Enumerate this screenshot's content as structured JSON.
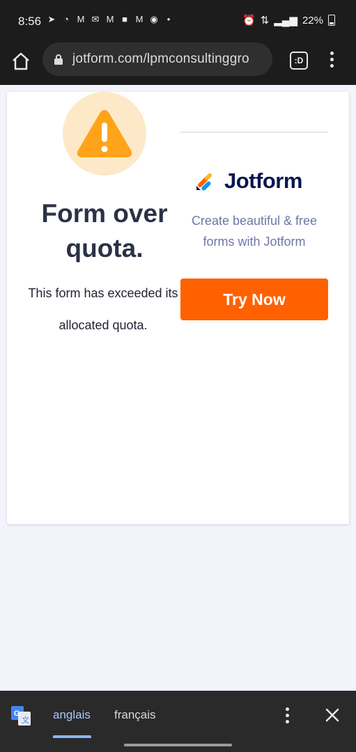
{
  "status_bar": {
    "time": "8:56",
    "battery": "22%",
    "notification_icons": [
      "telegram-icon",
      "whatsapp-icon",
      "gmail-icon",
      "mail-icon",
      "gmail-icon",
      "app-icon",
      "gmail-icon",
      "globe-icon"
    ]
  },
  "browser": {
    "url": "jotform.com/lpmconsultinggro",
    "tabs_label": ":D"
  },
  "content": {
    "title": "Form over quota.",
    "description": "This form has exceeded its allocated quota.",
    "brand_name": "Jotform",
    "tagline": "Create beautiful & free forms with Jotform",
    "cta_label": "Try Now",
    "colors": {
      "accent": "#ff6100",
      "warning": "#ffa31a",
      "brand_navy": "#0a1551"
    }
  },
  "translate_bar": {
    "source_language": "anglais",
    "target_language": "français"
  }
}
